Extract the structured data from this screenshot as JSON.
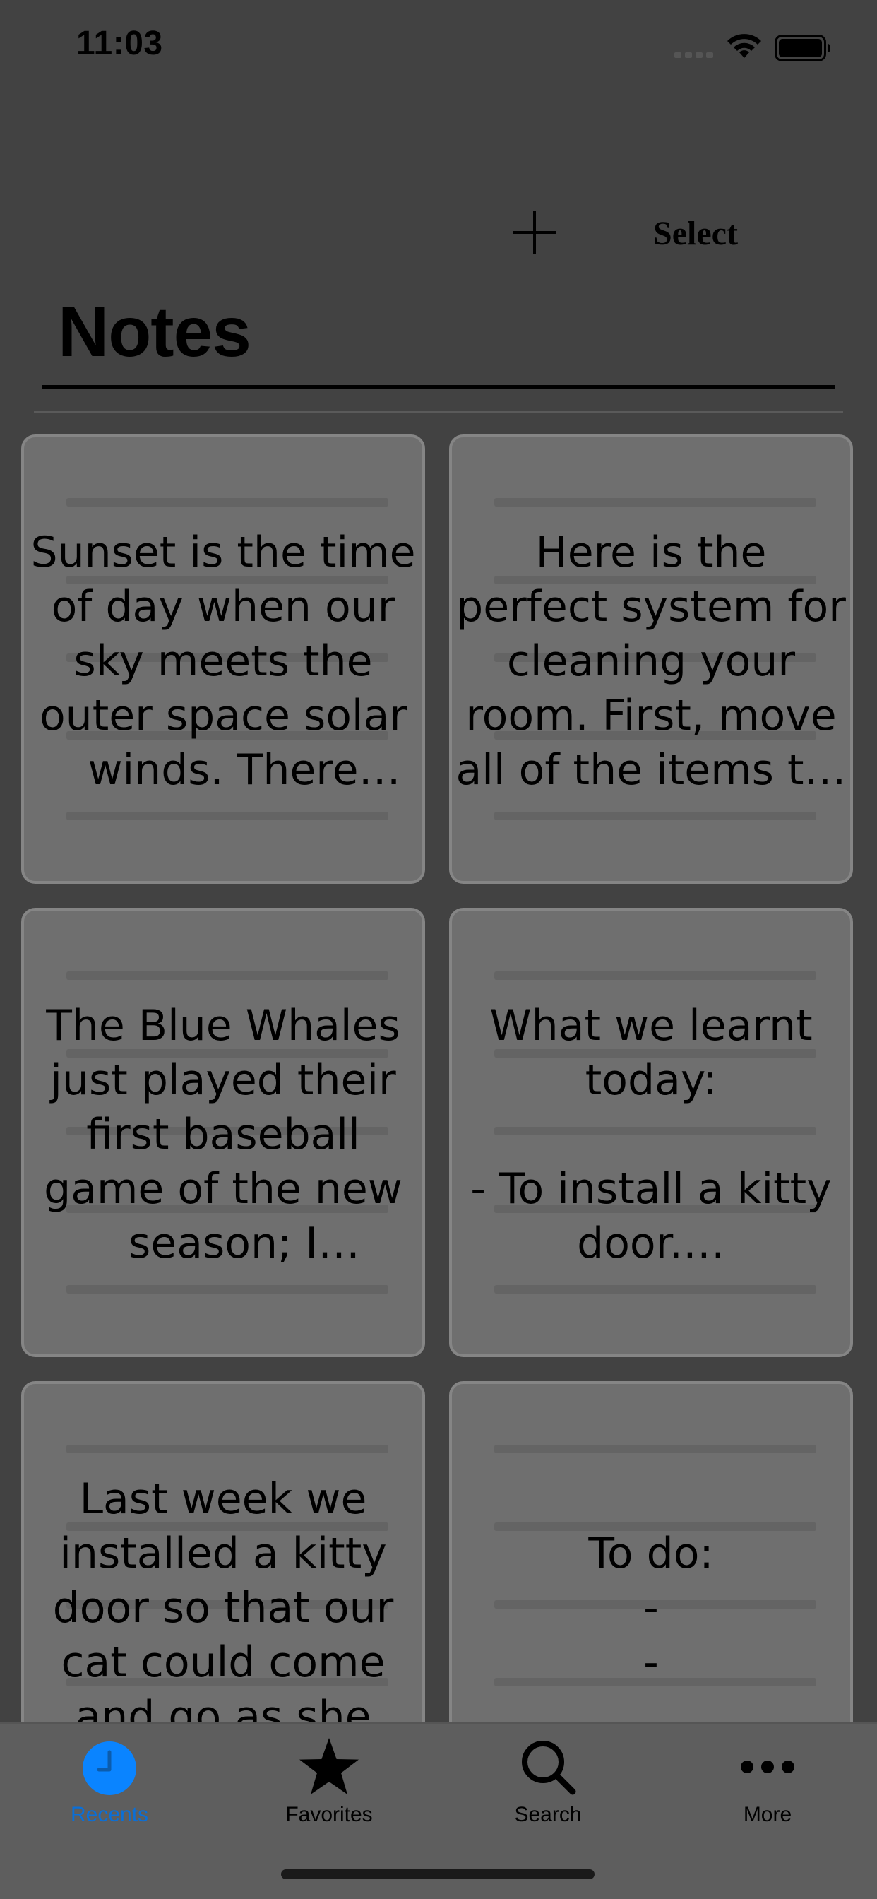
{
  "status_bar": {
    "time": "11:03"
  },
  "nav": {
    "add_icon": "plus-icon",
    "select_label": "Select",
    "title": "Notes"
  },
  "notes": [
    {
      "text": "Sunset is the time of day when our sky meets the outer space solar winds. There are…"
    },
    {
      "text": "Here is the perfect system for cleaning your room. First, move all of the items t…"
    },
    {
      "text": "The Blue Whales just played their first baseball game of the new season; I believe…"
    },
    {
      "text": "What we learnt today:\n\n- To install a kitty door.…"
    },
    {
      "text": "Last week we installed a kitty door so that our cat could come and go as she ple…"
    },
    {
      "text": "To do:\n-\n-"
    }
  ],
  "tab_bar": {
    "items": [
      {
        "label": "Recents",
        "icon": "clock-icon",
        "active": true
      },
      {
        "label": "Favorites",
        "icon": "star-icon",
        "active": false
      },
      {
        "label": "Search",
        "icon": "search-icon",
        "active": false
      },
      {
        "label": "More",
        "icon": "more-icon",
        "active": false
      }
    ]
  },
  "colors": {
    "accent": "#0a84ff",
    "background": "#424242",
    "card": "#6f6f6f"
  }
}
